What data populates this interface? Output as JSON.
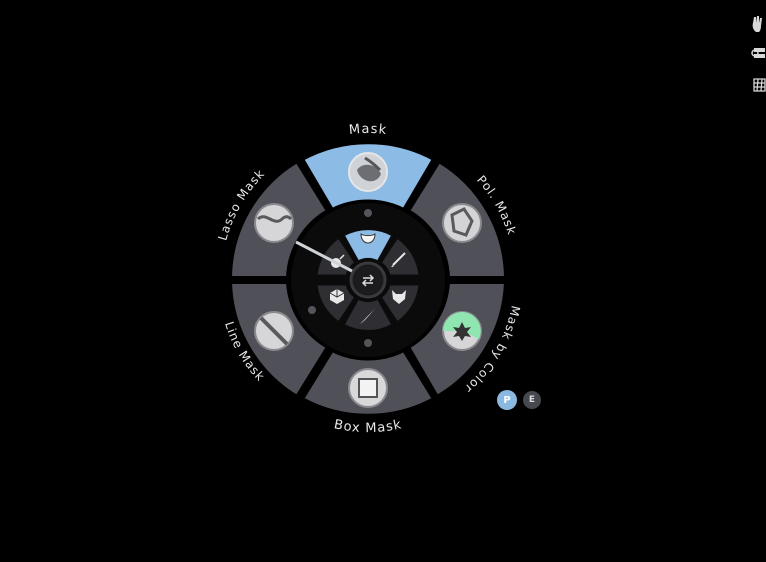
{
  "pie_menu": {
    "outer_items": [
      {
        "key": "mask",
        "label": "Mask",
        "icon": "mask-brush-icon",
        "selected": true
      },
      {
        "key": "pol_mask",
        "label": "Pol. Mask",
        "icon": "polygon-mask-icon",
        "selected": false
      },
      {
        "key": "mask_by_color",
        "label": "Mask by Color",
        "icon": "mask-by-color-icon",
        "selected": false
      },
      {
        "key": "box_mask",
        "label": "Box Mask",
        "icon": "box-mask-icon",
        "selected": false
      },
      {
        "key": "line_mask",
        "label": "Line Mask",
        "icon": "line-mask-icon",
        "selected": false
      },
      {
        "key": "lasso_mask",
        "label": "Lasso Mask",
        "icon": "lasso-mask-icon",
        "selected": false
      }
    ],
    "inner_items": [
      {
        "key": "mask_tool",
        "icon": "face-mask-icon",
        "selected": true
      },
      {
        "key": "brush",
        "icon": "brush-icon",
        "selected": false
      },
      {
        "key": "wolf",
        "icon": "wolf-mask-icon",
        "selected": false
      },
      {
        "key": "feather",
        "icon": "feather-icon",
        "selected": false
      },
      {
        "key": "cube",
        "icon": "cube-icon",
        "selected": false
      },
      {
        "key": "bomb",
        "icon": "bomb-icon",
        "selected": false
      }
    ],
    "center_icon": "swap-arrows-icon"
  },
  "mode_buttons": [
    {
      "key": "p",
      "label": "P",
      "active": true
    },
    {
      "key": "e",
      "label": "E",
      "active": false
    }
  ],
  "right_toolbar": [
    "hand-icon",
    "brush-stack-icon",
    "grid-icon"
  ],
  "colors": {
    "background": "#000000",
    "segment": "#505058",
    "segment_selected": "#8cbbe6",
    "inner_ring": "#0b0b0c",
    "inner_segment": "#2f2f33",
    "inner_selected": "#8cbbe6",
    "label": "#e8e8ea"
  }
}
